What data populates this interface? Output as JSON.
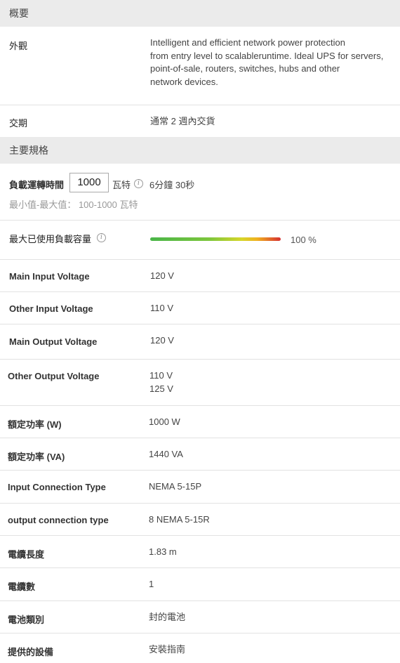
{
  "overview": {
    "header": "概要",
    "appearance_label": "外觀",
    "appearance_text": [
      "Intelligent and efficient network power protection",
      "from entry level to scalableruntime. Ideal UPS for servers,",
      "point-of-sale, routers, switches, hubs and other",
      "network devices."
    ],
    "delivery_label": "交期",
    "delivery_value": "通常 2 週內交貨"
  },
  "specs": {
    "header": "主要規格",
    "runtime": {
      "label": "負載運轉時間",
      "input_value": "1000",
      "unit": "瓦特",
      "result": "6分鐘 30秒",
      "range_hint": "最小值-最大值： 100-1000 瓦特"
    },
    "max_load": {
      "label": "最大已使用負載容量",
      "percent_text": "100 %",
      "level": 1.0
    },
    "rows": [
      {
        "label": "Main Input Voltage",
        "values": [
          "120 V"
        ]
      },
      {
        "label": "Other Input Voltage",
        "values": [
          "110 V"
        ]
      },
      {
        "label": "Main Output Voltage",
        "values": [
          "120 V"
        ]
      },
      {
        "label": "Other Output Voltage",
        "values": [
          "110 V",
          "125 V"
        ]
      },
      {
        "label": "額定功率 (W)",
        "values": [
          "1000 W"
        ]
      },
      {
        "label": "額定功率 (VA)",
        "values": [
          "1440 VA"
        ]
      },
      {
        "label": "Input Connection Type",
        "values": [
          "NEMA 5-15P"
        ]
      },
      {
        "label": "output connection type",
        "values": [
          "8 NEMA 5-15R"
        ]
      },
      {
        "label": "電纜長度",
        "values": [
          "1.83 m"
        ]
      },
      {
        "label": "電纜數",
        "values": [
          "1"
        ]
      },
      {
        "label": "電池類別",
        "values": [
          "封的電池"
        ]
      },
      {
        "label": "提供的設備",
        "values": [
          "安裝指南"
        ]
      }
    ]
  },
  "icons": {
    "info": "info-icon"
  },
  "colors": {
    "header_bg": "#ebebeb",
    "bar_start": "#49b549",
    "bar_end": "#d63030"
  }
}
